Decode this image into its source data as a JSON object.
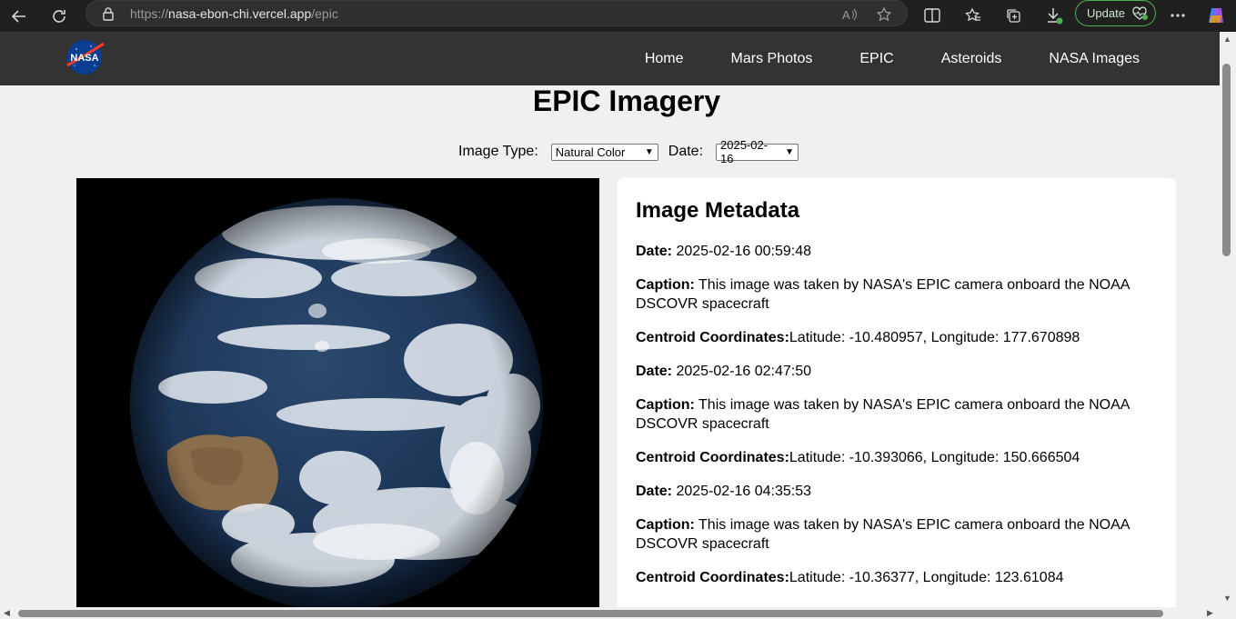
{
  "browser": {
    "url_scheme": "https://",
    "url_host": "nasa-ebon-chi.vercel.app",
    "url_path": "/epic",
    "update_label": "Update"
  },
  "header": {
    "logo_text": "NASA",
    "nav": [
      {
        "label": "Home"
      },
      {
        "label": "Mars Photos"
      },
      {
        "label": "EPIC"
      },
      {
        "label": "Asteroids"
      },
      {
        "label": "NASA Images"
      }
    ]
  },
  "page": {
    "title": "EPIC Imagery",
    "image_type_label": "Image Type:",
    "image_type_value": "Natural Color",
    "date_label": "Date:",
    "date_value": "2025-02-16"
  },
  "metadata": {
    "heading": "Image Metadata",
    "entries": [
      {
        "date_label": "Date:",
        "date": "2025-02-16 00:59:48",
        "caption_label": "Caption:",
        "caption": "This image was taken by NASA's EPIC camera onboard the NOAA DSCOVR spacecraft",
        "coords_label": "Centroid Coordinates:",
        "coords": "Latitude: -10.480957, Longitude: 177.670898"
      },
      {
        "date_label": "Date:",
        "date": "2025-02-16 02:47:50",
        "caption_label": "Caption:",
        "caption": "This image was taken by NASA's EPIC camera onboard the NOAA DSCOVR spacecraft",
        "coords_label": "Centroid Coordinates:",
        "coords": "Latitude: -10.393066, Longitude: 150.666504"
      },
      {
        "date_label": "Date:",
        "date": "2025-02-16 04:35:53",
        "caption_label": "Caption:",
        "caption": "This image was taken by NASA's EPIC camera onboard the NOAA DSCOVR spacecraft",
        "coords_label": "Centroid Coordinates:",
        "coords": "Latitude: -10.36377, Longitude: 123.61084"
      }
    ]
  },
  "colors": {
    "header_bg": "#333333",
    "page_bg": "#f0f0f0",
    "browser_bg": "#202020"
  }
}
